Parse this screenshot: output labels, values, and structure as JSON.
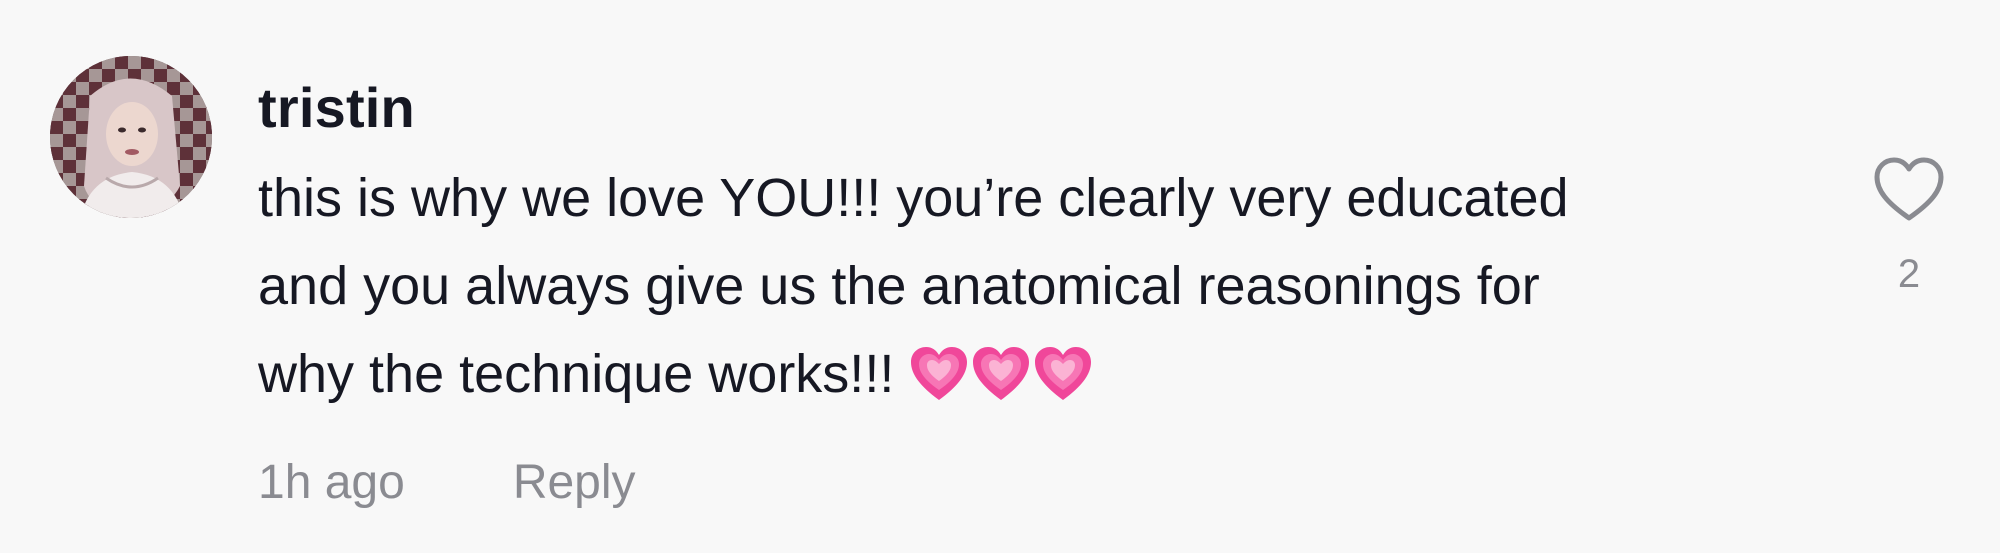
{
  "comment": {
    "username": "tristin",
    "text_lines": [
      "this is why we love YOU!!! you’re clearly very educated",
      "and you always give us the anatomical reasonings for",
      "why the technique works!!!"
    ],
    "emoji": [
      "growing-heart-emoji",
      "growing-heart-emoji",
      "growing-heart-emoji"
    ],
    "timestamp": "1h ago",
    "reply_label": "Reply",
    "like_count": "2",
    "like_icon": "heart-outline-icon"
  },
  "colors": {
    "background": "#f8f8f8",
    "primary_text": "#161823",
    "secondary_text": "#8a8b91",
    "heart_emoji": "#f0479a"
  }
}
